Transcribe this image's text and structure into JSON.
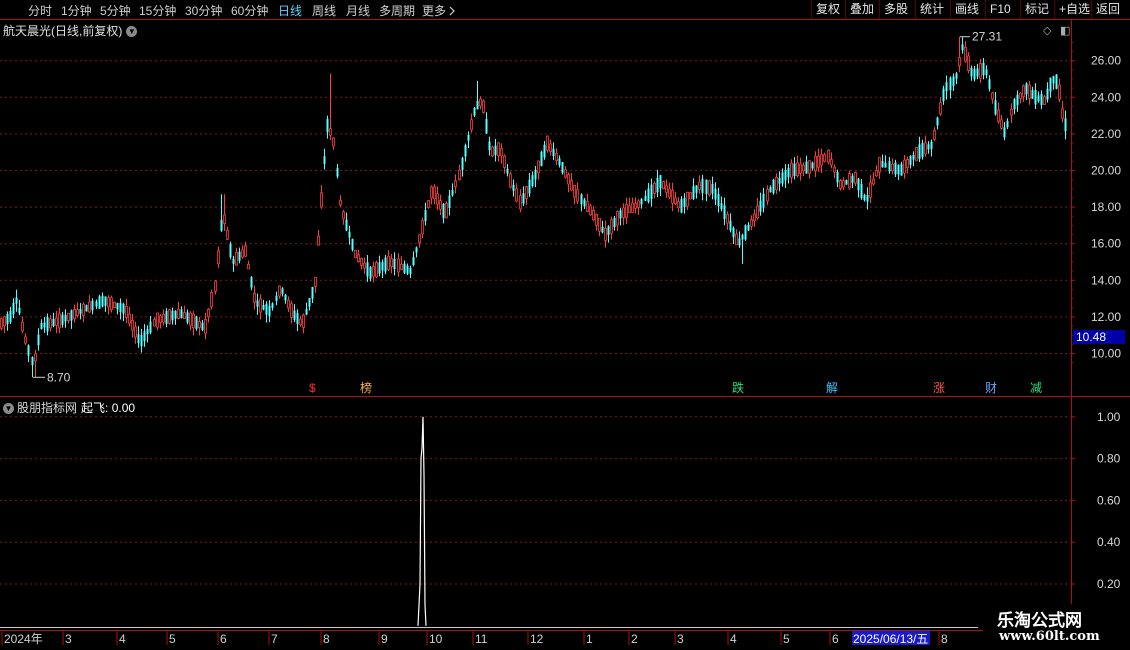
{
  "toolbar": {
    "periods": [
      {
        "label": "分时",
        "active": false
      },
      {
        "label": "1分钟",
        "active": false
      },
      {
        "label": "5分钟",
        "active": false
      },
      {
        "label": "15分钟",
        "active": false
      },
      {
        "label": "30分钟",
        "active": false
      },
      {
        "label": "60分钟",
        "active": false
      },
      {
        "label": "日线",
        "active": true
      },
      {
        "label": "周线",
        "active": false
      },
      {
        "label": "月线",
        "active": false
      },
      {
        "label": "多周期",
        "active": false
      },
      {
        "label": "更多",
        "active": false
      }
    ],
    "more_chevron": "chevron-right-icon",
    "buttons": [
      "复权",
      "叠加",
      "多股",
      "统计",
      "画线",
      "F10",
      "标记",
      "+自选",
      "返回"
    ]
  },
  "stock": {
    "name": "航天晨光",
    "mode": "(日线,前复权)",
    "dropdown_icon": "chevron-down-icon",
    "high_label": "27.31",
    "low_label": "8.70",
    "current_price": "10.48"
  },
  "indicator": {
    "source": "股朋指标网",
    "name": "起飞:",
    "value": "0.00",
    "ticks": [
      "1.00",
      "0.80",
      "0.60",
      "0.40",
      "0.20"
    ]
  },
  "events": [
    {
      "label": "$",
      "color": "#ff2a2a"
    },
    {
      "label": "榜",
      "color": "#ffb040"
    },
    {
      "label": "跌",
      "color": "#28e07a"
    },
    {
      "label": "解",
      "color": "#38c8ff"
    },
    {
      "label": "涨",
      "color": "#ff5050"
    },
    {
      "label": "财",
      "color": "#6aa8ff"
    },
    {
      "label": "减",
      "color": "#28e07a"
    }
  ],
  "time_axis": {
    "labels": [
      "2024年",
      "3",
      "4",
      "5",
      "6",
      "7",
      "8",
      "9",
      "10",
      "11",
      "12",
      "1",
      "2",
      "3",
      "4",
      "5",
      "6",
      "8"
    ],
    "cursor_date": "2025/06/13/五"
  },
  "price_ticks": [
    "26.00",
    "24.00",
    "22.00",
    "20.00",
    "18.00",
    "16.00",
    "14.00",
    "12.00",
    "10.00"
  ],
  "watermark": {
    "line1": "乐淘公式网",
    "line2": "www.60lt.com"
  },
  "colors": {
    "up": "#ff3c3c",
    "down": "#54ffff",
    "grid": "#7a1a1a",
    "axis": "#aa1111",
    "cursor_bg": "#1a1acc"
  },
  "chart_data": {
    "type": "candlestick",
    "title": "航天晨光(日线,前复权)",
    "ylim": [
      8.7,
      27.31
    ],
    "y_ticks": [
      10,
      12,
      14,
      16,
      18,
      20,
      22,
      24,
      26
    ],
    "series": [
      {
        "x": [
          "2024-01",
          "2024-02",
          "2024-03",
          "2024-04",
          "2024-05",
          "2024-06",
          "2024-07",
          "2024-08",
          "2024-09",
          "2024-10",
          "2024-11",
          "2024-12",
          "2025-01",
          "2025-02",
          "2025-03",
          "2025-04",
          "2025-05",
          "2025-06",
          "2025-08"
        ],
        "values": [
          11.8,
          9.6,
          12.0,
          12.6,
          11.3,
          14.5,
          12.2,
          19.0,
          14.6,
          18.5,
          22.8,
          19.5,
          16.8,
          18.6,
          18.4,
          16.8,
          19.9,
          20.5,
          24.5
        ]
      }
    ],
    "annotations": [
      {
        "label": "27.31",
        "type": "high"
      },
      {
        "label": "8.70",
        "type": "low"
      }
    ],
    "indicator": {
      "name": "起飞",
      "ylim": [
        0,
        1
      ],
      "spike_value": 1.0,
      "spike_month": "2024-09"
    }
  }
}
